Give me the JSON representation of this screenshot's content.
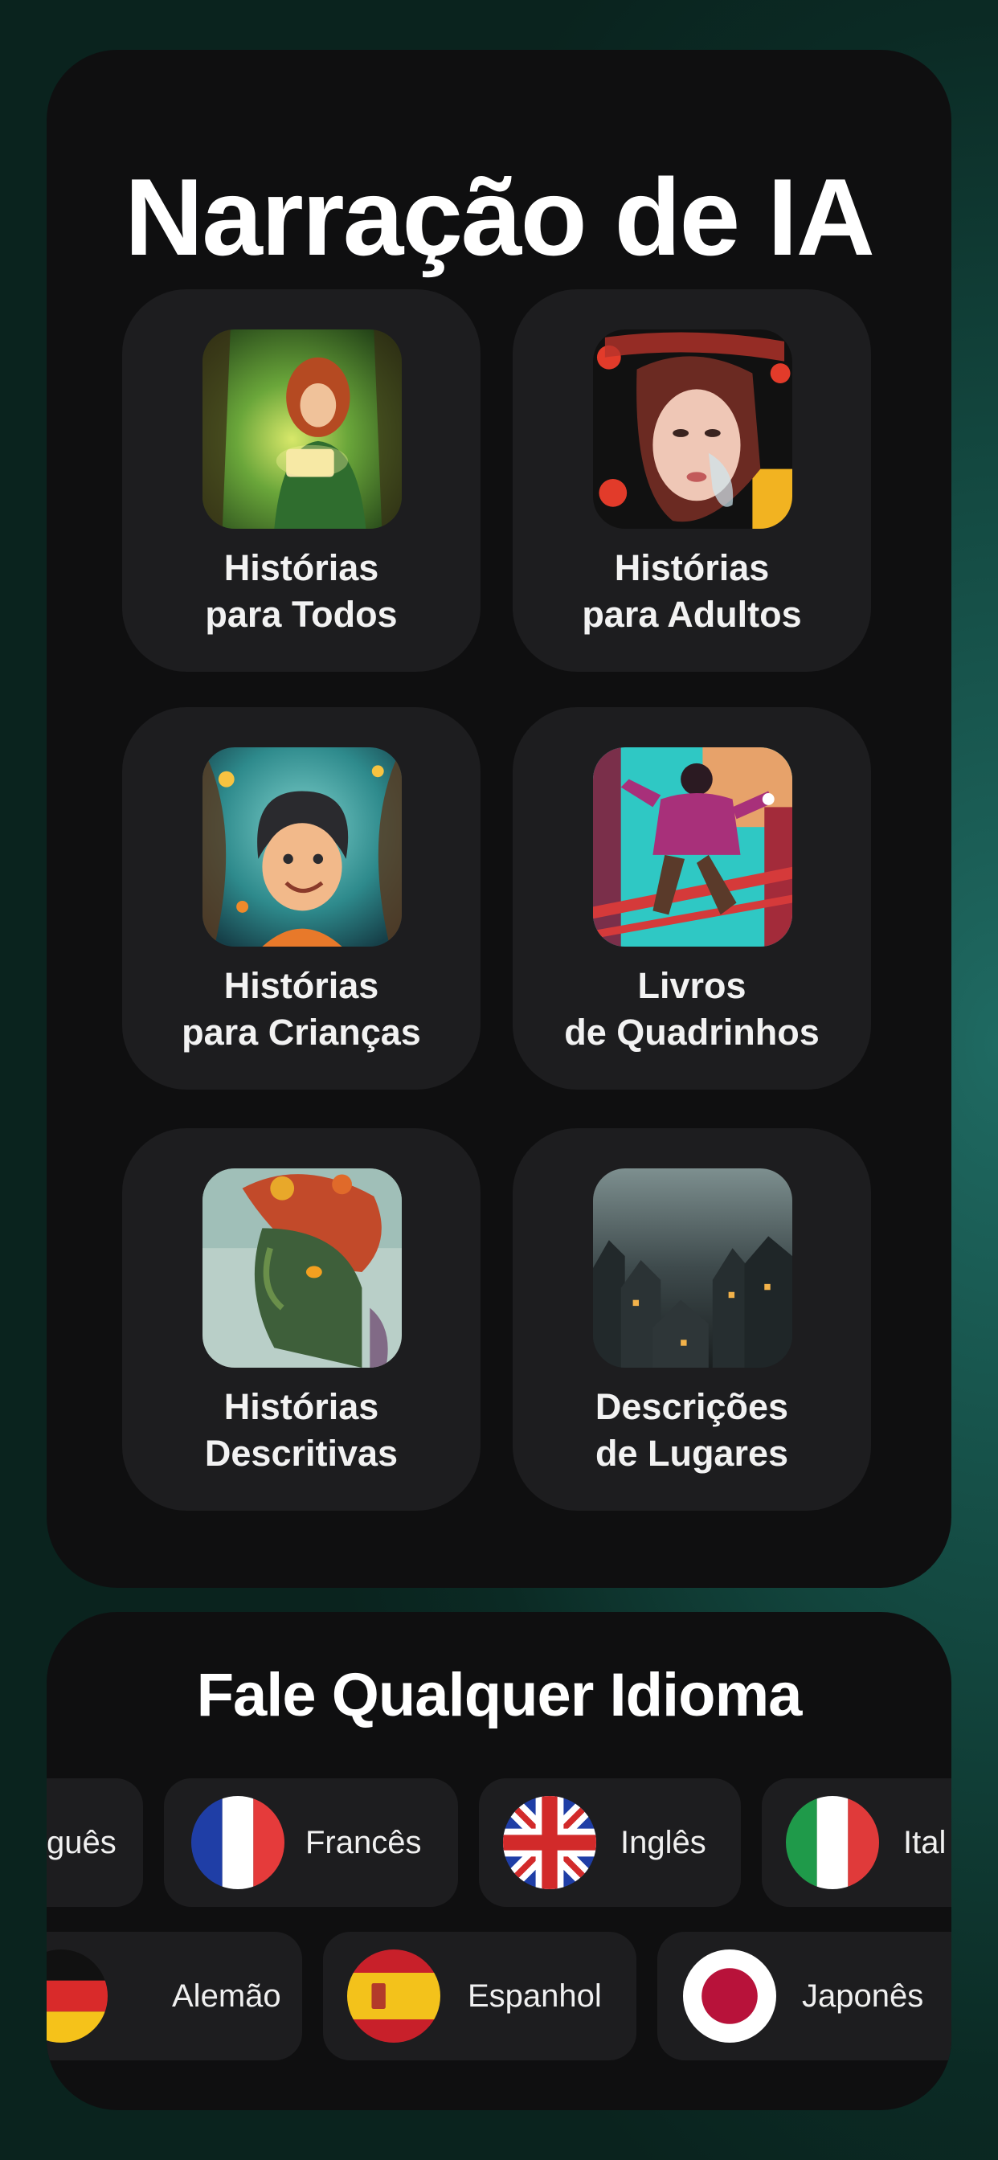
{
  "main": {
    "title": "Narração de IA",
    "cards": [
      {
        "line1": "Histórias",
        "line2": "para Todos",
        "image": "girl-reading-forest-image"
      },
      {
        "line1": "Histórias",
        "line2": "para Adultos",
        "image": "woman-portrait-image"
      },
      {
        "line1": "Histórias",
        "line2": "para Crianças",
        "image": "smiling-child-image"
      },
      {
        "line1": "Livros",
        "line2": "de Quadrinhos",
        "image": "comic-hero-image"
      },
      {
        "line1": "Histórias",
        "line2": "Descritivas",
        "image": "nature-face-image"
      },
      {
        "line1": "Descrições",
        "line2": "de Lugares",
        "image": "dark-village-image"
      }
    ]
  },
  "languages": {
    "title": "Fale Qualquer Idioma",
    "row1": [
      {
        "name": "guês",
        "flag": "portugal-flag-icon"
      },
      {
        "name": "Francês",
        "flag": "france-flag-icon"
      },
      {
        "name": "Inglês",
        "flag": "uk-flag-icon"
      },
      {
        "name": "Ital",
        "flag": "italy-flag-icon"
      }
    ],
    "row2": [
      {
        "name": "Alemão",
        "flag": "germany-flag-icon"
      },
      {
        "name": "Espanhol",
        "flag": "spain-flag-icon"
      },
      {
        "name": "Japonês",
        "flag": "japan-flag-icon"
      }
    ]
  }
}
